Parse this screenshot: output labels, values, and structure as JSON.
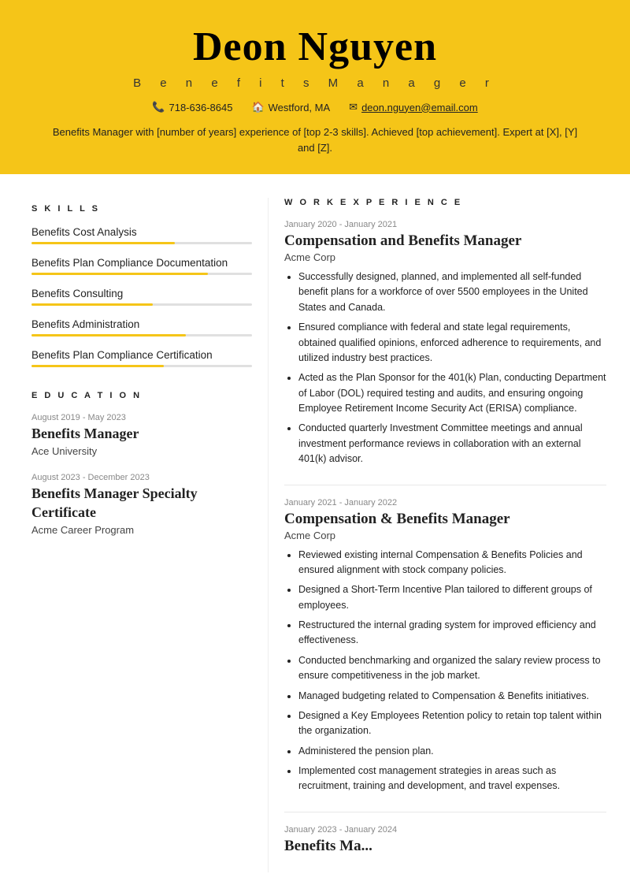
{
  "header": {
    "name": "Deon Nguyen",
    "title": "B e n e f i t s   M a n a g e r",
    "phone": "718-636-8645",
    "location": "Westford, MA",
    "email": "deon.nguyen@email.com",
    "summary": "Benefits Manager with [number of years] experience of [top 2-3 skills]. Achieved [top achievement]. Expert at [X], [Y] and [Z]."
  },
  "skills_header": "S K I L L S",
  "skills": [
    {
      "name": "Benefits Cost Analysis",
      "fill_pct": 65
    },
    {
      "name": "Benefits Plan Compliance Documentation",
      "fill_pct": 80
    },
    {
      "name": "Benefits Consulting",
      "fill_pct": 55
    },
    {
      "name": "Benefits Administration",
      "fill_pct": 70
    },
    {
      "name": "Benefits Plan Compliance Certification",
      "fill_pct": 60
    }
  ],
  "education_header": "E D U C A T I O N",
  "education": [
    {
      "dates": "August 2019 - May 2023",
      "degree": "Benefits Manager",
      "institution": "Ace University"
    },
    {
      "dates": "August 2023 - December 2023",
      "degree": "Benefits Manager Specialty Certificate",
      "institution": "Acme Career Program"
    }
  ],
  "work_header": "W O R K  E X P E R I E N C E",
  "jobs": [
    {
      "dates": "January 2020 - January 2021",
      "title": "Compensation and Benefits Manager",
      "company": "Acme Corp",
      "bullets": [
        "Successfully designed, planned, and implemented all self-funded benefit plans for a workforce of over 5500 employees in the United States and Canada.",
        "Ensured compliance with federal and state legal requirements, obtained qualified opinions, enforced adherence to requirements, and utilized industry best practices.",
        "Acted as the Plan Sponsor for the 401(k) Plan, conducting Department of Labor (DOL) required testing and audits, and ensuring ongoing Employee Retirement Income Security Act (ERISA) compliance.",
        "Conducted quarterly Investment Committee meetings and annual investment performance reviews in collaboration with an external 401(k) advisor."
      ]
    },
    {
      "dates": "January 2021 - January 2022",
      "title": "Compensation & Benefits Manager",
      "company": "Acme Corp",
      "bullets": [
        "Reviewed existing internal Compensation & Benefits Policies and ensured alignment with stock company policies.",
        "Designed a Short-Term Incentive Plan tailored to different groups of employees.",
        "Restructured the internal grading system for improved efficiency and effectiveness.",
        "Conducted benchmarking and organized the salary review process to ensure competitiveness in the job market.",
        "Managed budgeting related to Compensation & Benefits initiatives.",
        "Designed a Key Employees Retention policy to retain top talent within the organization.",
        "Administered the pension plan.",
        "Implemented cost management strategies in areas such as recruitment, training and development, and travel expenses."
      ]
    },
    {
      "dates": "January 2023 - January 2024",
      "title": "Benefits Ma...",
      "company": "",
      "bullets": []
    }
  ]
}
